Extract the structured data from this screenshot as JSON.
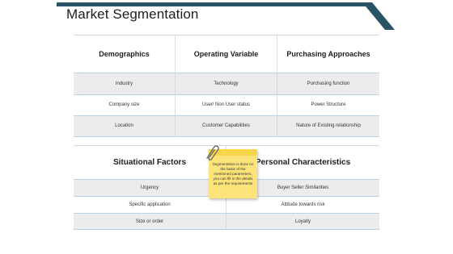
{
  "title": "Market Segmentation",
  "table1": {
    "headers": [
      "Demographics",
      "Operating Variable",
      "Purchasing Approaches"
    ],
    "rows": [
      [
        "Industry",
        "Technology",
        "Purchasing function"
      ],
      [
        "Company size",
        "User/ Non User status",
        "Power Structure"
      ],
      [
        "Location",
        "Customer Capabilities",
        "Nature of Existing relationship"
      ]
    ]
  },
  "table2": {
    "headers": [
      "Situational Factors",
      "Personal Characteristics"
    ],
    "rows": [
      [
        "Urgency",
        "Buyer Seller Similarities"
      ],
      [
        "Specific application",
        "Attitude towards risk"
      ],
      [
        "Size or order",
        "Loyalty"
      ]
    ]
  },
  "note": {
    "text": "Segmentation is done on the basis of the mentioned parameters, you can fill in the details as per the requirements"
  },
  "colors": {
    "accent": "#2a5366",
    "row_shade": "#ececec",
    "note": "#fde47a"
  },
  "icons": [
    "paperclip-icon"
  ]
}
